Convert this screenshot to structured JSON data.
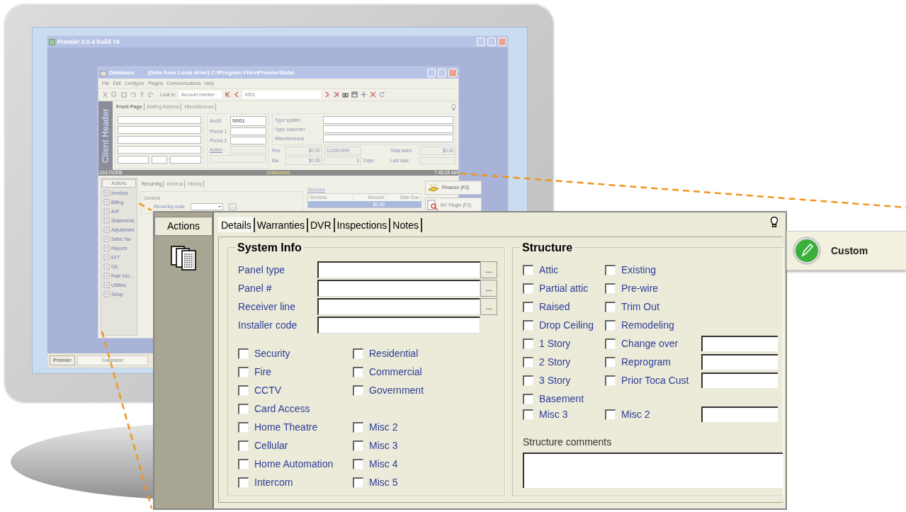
{
  "premier_window": {
    "title": "Premier 2.0.4 build 74",
    "taskbar_button": "Premier",
    "taskbar_task": "Database"
  },
  "database_window": {
    "title": "Database",
    "subtitle": "(Data from Local drive) C:\\Program Files\\Premier\\Data\\",
    "menu": [
      "File",
      "Edit",
      "Configure",
      "Plugins",
      "Communications",
      "Help"
    ],
    "toolbar": {
      "look_in_label": "Look in:",
      "look_in_value": "Account number",
      "record": "0001"
    },
    "side_label": "Client Header",
    "header_tabs": [
      {
        "label": "Front Page",
        "selected": true
      },
      {
        "label": "Mailing Address",
        "selected": false
      },
      {
        "label": "Miscellaneous",
        "selected": false
      }
    ],
    "acct": {
      "label": "Acct#",
      "value": "0001"
    },
    "phone_labels": [
      "Phone 1",
      "Phone 2"
    ],
    "action_link": "Action",
    "type_fields": [
      "Type system",
      "Type customer",
      "Miscellaneous"
    ],
    "res": {
      "label": "Res",
      "amount": "$0.00",
      "date": "12/30/1899"
    },
    "bal": {
      "label": "Bal",
      "amount": "$0.00",
      "days": "0",
      "days_label": "Days"
    },
    "total_sales": {
      "label": "Total sales",
      "value": "$0.00"
    },
    "last_sale_label": "Last sale",
    "status_bar": {
      "date": "10/17/2006",
      "license": "Unlicensed",
      "time": "7:46:18 AM"
    },
    "actions_title": "Actions",
    "actions": [
      "Invoices",
      "Billing",
      "A/R",
      "Statements",
      "Adjustment",
      "Sales Tax",
      "Reports",
      "EFT",
      "G/L",
      "Rate Incr...",
      "Utilities",
      "Setup"
    ],
    "lower_tabs": [
      {
        "label": "Recurring",
        "selected": true
      },
      {
        "label": "General",
        "selected": false
      },
      {
        "label": "History",
        "selected": false
      }
    ],
    "general_group": "General",
    "recurring_code_label": "Recurring code",
    "browse": "...",
    "services": {
      "title": "Services",
      "columns": [
        "Services",
        "Amount",
        "Date Due"
      ],
      "amount": "$0.00"
    },
    "plugins": [
      "Finance (F2)",
      "MY Plugin (F3)"
    ]
  },
  "detail_window": {
    "actions_title": "Actions",
    "tabs": [
      {
        "label": "Details",
        "selected": true
      },
      {
        "label": "Warranties",
        "selected": false
      },
      {
        "label": "DVR",
        "selected": false
      },
      {
        "label": "Inspections",
        "selected": false
      },
      {
        "label": "Notes",
        "selected": false
      }
    ],
    "system_info": {
      "title": "System Info",
      "fields": [
        {
          "label": "Panel type",
          "browse": "..."
        },
        {
          "label": "Panel #",
          "browse": "..."
        },
        {
          "label": "Receiver line",
          "browse": "..."
        },
        {
          "label": "Installer code"
        }
      ],
      "left_checks": [
        {
          "label": "Security",
          "checked": false
        },
        {
          "label": "Fire",
          "checked": false
        },
        {
          "label": "CCTV",
          "checked": false
        },
        {
          "label": "Card Access",
          "checked": false
        },
        {
          "label": "Home Theatre",
          "checked": false
        },
        {
          "label": "Cellular",
          "checked": false
        },
        {
          "label": "Home Automation",
          "checked": false
        },
        {
          "label": "Intercom",
          "checked": false
        }
      ],
      "right_check_groups": [
        [
          {
            "label": "Residential",
            "checked": false
          },
          {
            "label": "Commercial",
            "checked": false
          },
          {
            "label": "Government",
            "checked": false
          }
        ],
        [
          {
            "label": "Misc 2",
            "checked": false
          },
          {
            "label": "Misc 3",
            "checked": false
          },
          {
            "label": "Misc 4",
            "checked": false
          },
          {
            "label": "Misc 5",
            "checked": false
          }
        ]
      ]
    },
    "structure": {
      "title": "Structure",
      "rows": [
        {
          "left": {
            "label": "Attic",
            "checked": false
          },
          "right": {
            "label": "Existing",
            "checked": false
          }
        },
        {
          "left": {
            "label": "Partial attic",
            "checked": false
          },
          "right": {
            "label": "Pre-wire",
            "checked": false
          }
        },
        {
          "left": {
            "label": "Raised",
            "checked": false
          },
          "right": {
            "label": "Trim Out",
            "checked": false
          }
        },
        {
          "left": {
            "label": "Drop Ceiling",
            "checked": false
          },
          "right": {
            "label": "Remodeling",
            "checked": false
          }
        },
        {
          "left": {
            "label": "1 Story",
            "checked": false
          },
          "right": {
            "label": "Change over",
            "checked": false,
            "field": true
          }
        },
        {
          "left": {
            "label": "2 Story",
            "checked": false
          },
          "right": {
            "label": "Reprogram",
            "checked": false,
            "field": true
          }
        },
        {
          "left": {
            "label": "3 Story",
            "checked": false
          },
          "right": {
            "label": "Prior Toca Cust",
            "checked": false,
            "field": true
          }
        },
        {
          "left": {
            "label": "Basement",
            "checked": false
          }
        },
        {
          "left": {
            "label": "Misc 3",
            "checked": false
          },
          "right": {
            "label": "Misc 2",
            "checked": false,
            "field": true
          }
        }
      ],
      "comments_label": "Structure comments"
    }
  },
  "custom_button": {
    "label": "Custom"
  }
}
